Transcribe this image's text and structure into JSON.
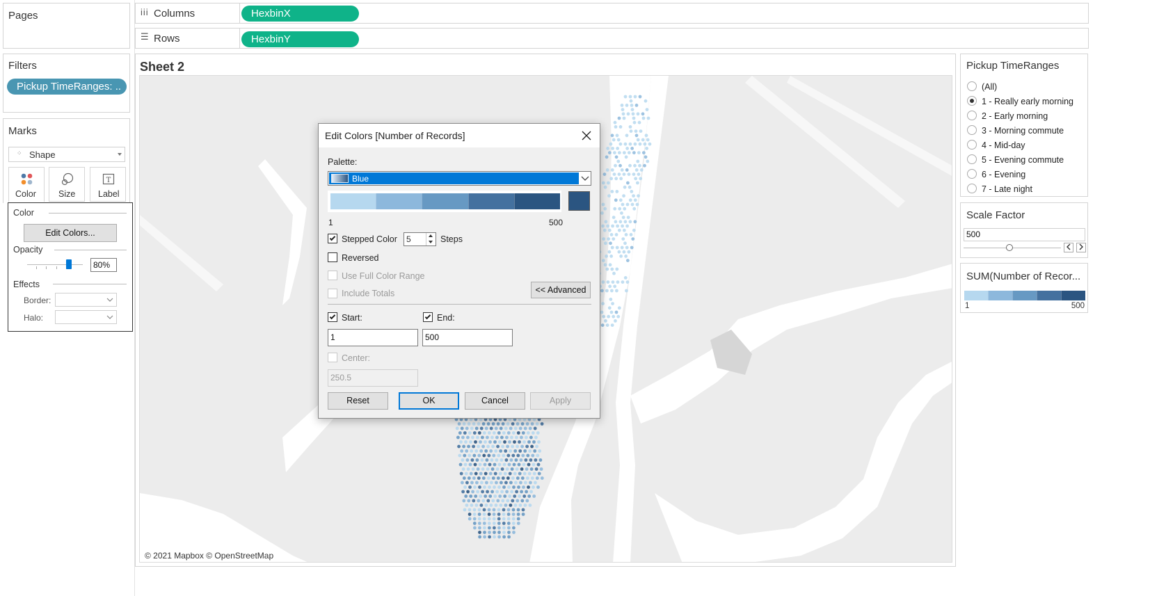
{
  "pages": {
    "title": "Pages"
  },
  "shelves": {
    "columns": {
      "label": "Columns",
      "pill": "HexbinX"
    },
    "rows": {
      "label": "Rows",
      "pill": "HexbinY"
    }
  },
  "filters": {
    "title": "Filters",
    "pill": "Pickup TimeRanges: .."
  },
  "marks": {
    "title": "Marks",
    "type": "Shape",
    "buttons": {
      "color": "Color",
      "size": "Size",
      "label": "Label"
    },
    "color_panel": {
      "title": "Color",
      "edit_button": "Edit Colors...",
      "opacity_label": "Opacity",
      "opacity_value": "80%",
      "effects_label": "Effects",
      "border_label": "Border:",
      "halo_label": "Halo:"
    }
  },
  "sheet": {
    "title": "Sheet 2",
    "attribution": "© 2021 Mapbox © OpenStreetMap"
  },
  "pickup_filter": {
    "title": "Pickup TimeRanges",
    "options": [
      {
        "label": "(All)",
        "selected": false
      },
      {
        "label": "1 - Really early morning",
        "selected": true
      },
      {
        "label": "2 - Early morning",
        "selected": false
      },
      {
        "label": "3 - Morning commute",
        "selected": false
      },
      {
        "label": "4 - Mid-day",
        "selected": false
      },
      {
        "label": "5 - Evening commute",
        "selected": false
      },
      {
        "label": "6 - Evening",
        "selected": false
      },
      {
        "label": "7 - Late night",
        "selected": false
      }
    ]
  },
  "scale_factor": {
    "title": "Scale Factor",
    "value": "500"
  },
  "legend": {
    "title": "SUM(Number of Recor...",
    "min": "1",
    "max": "500"
  },
  "dialog": {
    "title": "Edit Colors [Number of Records]",
    "palette_label": "Palette:",
    "palette_value": "Blue",
    "range_min": "1",
    "range_max": "500",
    "stepped_color_label": "Stepped Color",
    "stepped_color_checked": true,
    "steps_value": "5",
    "steps_label": "Steps",
    "reversed_label": "Reversed",
    "reversed_checked": false,
    "full_range_label": "Use Full Color Range",
    "include_totals_label": "Include Totals",
    "advanced_button": "<< Advanced",
    "start_label": "Start:",
    "start_checked": true,
    "start_value": "1",
    "end_label": "End:",
    "end_checked": true,
    "end_value": "500",
    "center_label": "Center:",
    "center_value": "250.5",
    "buttons": {
      "reset": "Reset",
      "ok": "OK",
      "cancel": "Cancel",
      "apply": "Apply"
    }
  },
  "colors": {
    "pill_green": "#0fb389",
    "pill_blue": "#4996b2",
    "dialog_select": "#0078d7",
    "steps": [
      "#b6d8ef",
      "#8db8dc",
      "#6799c3",
      "#44719f",
      "#2b5581"
    ],
    "map_land": "#ececec",
    "map_water": "#ffffff"
  }
}
